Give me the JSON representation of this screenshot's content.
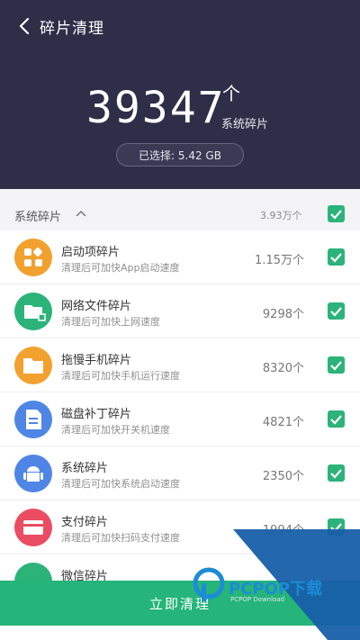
{
  "header": {
    "title": "碎片清理",
    "big_count": "39347",
    "unit": "个",
    "unit_sub": "系统碎片",
    "selected": "已选择: 5.42 GB"
  },
  "group": {
    "label": "系统碎片",
    "count": "3.93万个"
  },
  "items": [
    {
      "title": "启动项碎片",
      "desc": "清理后可加快App启动速度",
      "count": "1.15万个",
      "color": "#f2a12f"
    },
    {
      "title": "网络文件碎片",
      "desc": "清理后可加快上网速度",
      "count": "9298个",
      "color": "#2bb37a"
    },
    {
      "title": "拖慢手机碎片",
      "desc": "清理后可加快手机运行速度",
      "count": "8320个",
      "color": "#f2a12f"
    },
    {
      "title": "磁盘补丁碎片",
      "desc": "清理后可加快开关机速度",
      "count": "4821个",
      "color": "#4f86e6"
    },
    {
      "title": "系统碎片",
      "desc": "清理后可加快系统启动速度",
      "count": "2350个",
      "color": "#4f86e6"
    },
    {
      "title": "支付碎片",
      "desc": "清理后可加快扫码支付速度",
      "count": "1994个",
      "color": "#ea4d62"
    },
    {
      "title": "微信碎片",
      "desc": "",
      "count": "",
      "color": "#2bb37a"
    }
  ],
  "action": {
    "clean_label": "立即清理"
  },
  "watermark": {
    "brand": "PCPOP下载",
    "sub": "PCPOP Download"
  },
  "colors": {
    "header_bg": "#2e2e48",
    "accent_green": "#25b47a"
  }
}
